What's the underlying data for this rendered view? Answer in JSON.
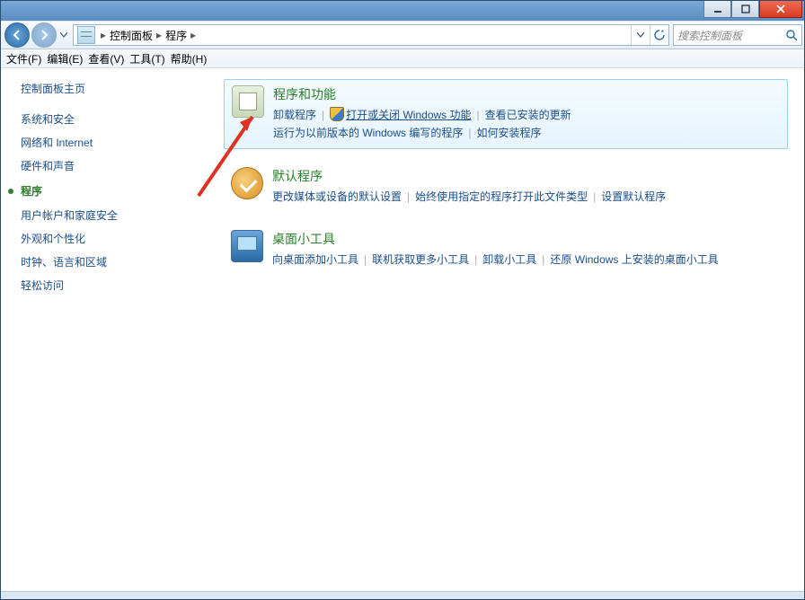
{
  "titlebar": {
    "minimize_icon": "minimize",
    "maximize_icon": "maximize",
    "close_icon": "close"
  },
  "breadcrumb": {
    "items": [
      "控制面板",
      "程序"
    ],
    "separator": "▸"
  },
  "search": {
    "placeholder": "搜索控制面板"
  },
  "menu": [
    "文件(F)",
    "编辑(E)",
    "查看(V)",
    "工具(T)",
    "帮助(H)"
  ],
  "sidebar": {
    "home": "控制面板主页",
    "items": [
      "系统和安全",
      "网络和 Internet",
      "硬件和声音",
      "程序",
      "用户帐户和家庭安全",
      "外观和个性化",
      "时钟、语言和区域",
      "轻松访问"
    ],
    "active_index": 3
  },
  "categories": [
    {
      "key": "programs",
      "title": "程序和功能",
      "selected": true,
      "rows": [
        [
          {
            "type": "link",
            "text": "卸载程序"
          },
          {
            "type": "sep"
          },
          {
            "type": "shield"
          },
          {
            "type": "link",
            "text": "打开或关闭 Windows 功能",
            "u": true
          },
          {
            "type": "sep"
          },
          {
            "type": "link",
            "text": "查看已安装的更新"
          }
        ],
        [
          {
            "type": "link",
            "text": "运行为以前版本的 Windows 编写的程序"
          },
          {
            "type": "sep"
          },
          {
            "type": "link",
            "text": "如何安装程序"
          }
        ]
      ]
    },
    {
      "key": "default",
      "title": "默认程序",
      "rows": [
        [
          {
            "type": "link",
            "text": "更改媒体或设备的默认设置"
          },
          {
            "type": "sep"
          },
          {
            "type": "link",
            "text": "始终使用指定的程序打开此文件类型"
          },
          {
            "type": "sep"
          },
          {
            "type": "link",
            "text": "设置默认程序"
          }
        ]
      ]
    },
    {
      "key": "gadgets",
      "title": "桌面小工具",
      "rows": [
        [
          {
            "type": "link",
            "text": "向桌面添加小工具"
          },
          {
            "type": "sep"
          },
          {
            "type": "link",
            "text": "联机获取更多小工具"
          },
          {
            "type": "sep"
          },
          {
            "type": "link",
            "text": "卸载小工具"
          },
          {
            "type": "sep"
          },
          {
            "type": "link",
            "text": "还原 Windows 上安装的桌面小工具"
          }
        ]
      ]
    }
  ]
}
